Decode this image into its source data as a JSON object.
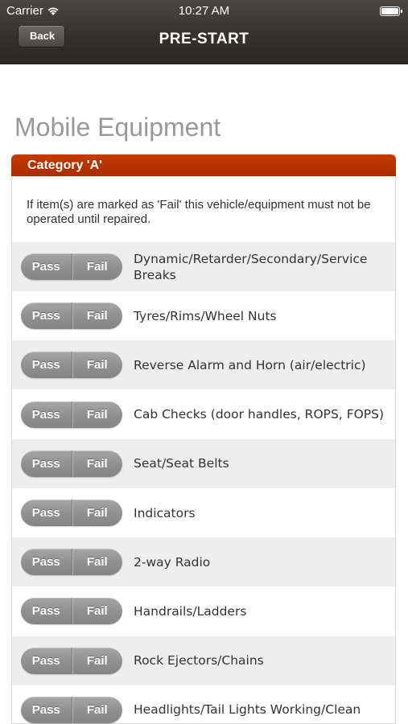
{
  "status_bar": {
    "carrier": "Carrier",
    "time": "10:27 AM"
  },
  "nav": {
    "back_label": "Back",
    "title": "PRE-START"
  },
  "heading": "Mobile Equipment",
  "category": "Category 'A'",
  "notice": "If item(s) are marked as 'Fail' this vehicle/equipment must not be operated until repaired.",
  "pass_label": "Pass",
  "fail_label": "Fail",
  "items": [
    "Dynamic/Retarder/Secondary/Service Breaks",
    "Tyres/Rims/Wheel Nuts",
    "Reverse Alarm and Horn (air/electric)",
    "Cab Checks (door handles, ROPS, FOPS)",
    "Seat/Seat Belts",
    "Indicators",
    "2-way Radio",
    "Handrails/Ladders",
    "Rock Ejectors/Chains",
    "Headlights/Tail Lights Working/Clean"
  ]
}
